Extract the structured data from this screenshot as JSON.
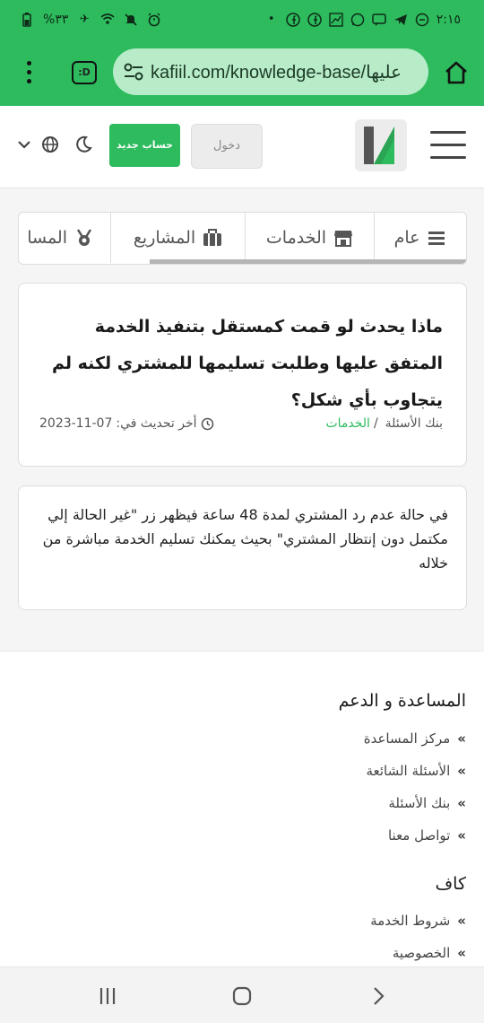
{
  "status_bar": {
    "time": "٢:١٥",
    "battery": "%٣٣"
  },
  "browser": {
    "url": "kafiil.com/knowledge-base/عليها",
    "tab_label": ":D"
  },
  "header": {
    "login_label": "دخول",
    "signup_label": "حساب جديد"
  },
  "tabs": [
    {
      "label": "عام",
      "icon": "list-icon"
    },
    {
      "label": "الخدمات",
      "icon": "store-icon"
    },
    {
      "label": "المشاريع",
      "icon": "briefcase-icon"
    },
    {
      "label": "المسا",
      "icon": "medal-icon"
    }
  ],
  "question": {
    "title": "ماذا يحدث لو قمت كمستقل بتنفيذ الخدمة المتفق عليها وطلبت تسليمها للمشتري لكنه لم يتجاوب بأي شكل؟",
    "breadcrumb_root": "بنك الأسئلة",
    "breadcrumb_sep": "/",
    "breadcrumb_category": "الخدمات",
    "updated_label": "أخر تحديث في:",
    "updated_date": "2023-11-07"
  },
  "answer": {
    "text": "في حالة عدم رد المشتري لمدة 48 ساعة فيظهر زر \"غير الحالة إلي مكتمل دون إنتظار المشتري\" بحيث يمكنك تسليم الخدمة مباشرة من خلاله"
  },
  "footer": {
    "support_heading": "المساعدة و الدعم",
    "support_links": [
      "مركز المساعدة",
      "الأسئلة الشائعة",
      "بنك الأسئلة",
      "تواصل معنا"
    ],
    "kafiil_heading": "كاف",
    "kafiil_links": [
      "شروط الخدمة",
      "الخصوصية"
    ]
  },
  "colors": {
    "brand_green": "#2dbb5d",
    "url_bar": "#b8ecc9"
  }
}
